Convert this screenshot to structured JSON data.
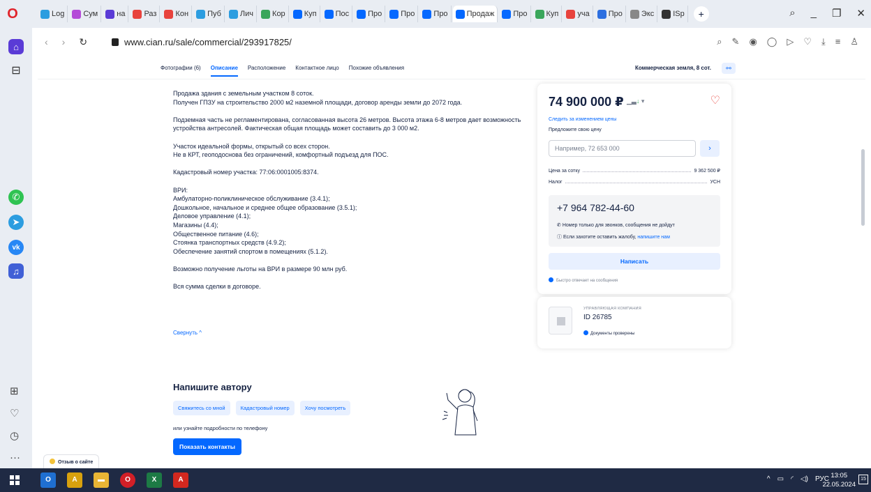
{
  "browser": {
    "tabs": [
      {
        "label": "Log",
        "color": "#2c9de0"
      },
      {
        "label": "Сум",
        "color": "#b44bd8"
      },
      {
        "label": "на",
        "color": "#5a3bd6"
      },
      {
        "label": "Раз",
        "color": "#e8433d"
      },
      {
        "label": "Кон",
        "color": "#e8433d"
      },
      {
        "label": "Пуб",
        "color": "#2c9de0"
      },
      {
        "label": "Лич",
        "color": "#2c9de0"
      },
      {
        "label": "Кор",
        "color": "#3aa65b"
      },
      {
        "label": "Куп",
        "color": "#0468ff"
      },
      {
        "label": "Пос",
        "color": "#0468ff"
      },
      {
        "label": "Про",
        "color": "#0468ff"
      },
      {
        "label": "Про",
        "color": "#0468ff"
      },
      {
        "label": "Про",
        "color": "#0468ff"
      },
      {
        "label": "Продаж",
        "color": "#0468ff",
        "active": true
      },
      {
        "label": "Про",
        "color": "#0468ff"
      },
      {
        "label": "Куп",
        "color": "#3aa65b"
      },
      {
        "label": "уча",
        "color": "#e8433d"
      },
      {
        "label": "Про",
        "color": "#2c6fe0"
      },
      {
        "label": "Экс",
        "color": "#888888"
      },
      {
        "label": "ISp",
        "color": "#333333"
      }
    ],
    "url": "www.cian.ru/sale/commercial/293917825/"
  },
  "subnav": {
    "tabs": [
      "Фотографии (6)",
      "Описание",
      "Расположение",
      "Контактное лицо",
      "Похожие объявления"
    ],
    "right_label": "Коммерческая земля, 8 сот."
  },
  "description": {
    "paragraphs": [
      "Продажа здания с земельным участком 8 соток.\nПолучен ГПЗУ на строительство 2000 м2 наземной площади, договор аренды земли до 2072 года.",
      "Подземная часть не регламентирована, согласованная высота 26 метров. Высота этажа 6-8 метров дает возможность устройства антресолей. Фактическая общая площадь может составить до 3 000 м2.",
      "Участок идеальной формы, открытый со всех сторон.\nНе в КРТ, геоподоснова без ограничений, комфортный подъезд для ПОС.",
      "Кадастровый номер участка: 77:06:0001005:8374.",
      "ВРИ:\nАмбулаторно-поликлиническое обслуживание (3.4.1);\nДошкольное, начальное и среднее общее образование (3.5.1);\nДеловое управление (4.1);\nМагазины (4.4);\nОбщественное питание (4.6);\nСтоянка транспортных средств (4.9.2);\nОбеспечение занятий спортом в помещениях (5.1.2).",
      "Возможно получение льготы на ВРИ в размере 90 млн руб.",
      "Вся сумма сделки в договоре."
    ],
    "collapse_label": "Свернуть ^"
  },
  "contact_author": {
    "title": "Напишите автору",
    "chips": [
      "Свяжитесь со мной",
      "Кадастровый номер",
      "Хочу посмотреть"
    ],
    "phone_hint": "или узнайте подробности по телефону",
    "button": "Показать контакты"
  },
  "price_card": {
    "price": "74 900 000 ₽",
    "track_link": "Следить за изменением цены",
    "offer_label": "Предложите свою цену",
    "offer_placeholder": "Например, 72 653 000",
    "price_per_sotka_label": "Цена за сотку",
    "price_per_sotka_value": "9 362 500 ₽",
    "tax_label": "Налог",
    "tax_value": "УСН",
    "phone": "+7 964 782-44-60",
    "note_calls": "Номер только для звонков, сообщения не дойдут",
    "note_complaint": "Если захотите оставить жалобу,",
    "note_complaint_link": "напишите нам",
    "write_button": "Написать",
    "fast_reply": "Быстро отвечает на сообщения"
  },
  "agency": {
    "kind": "УПРАВЛЯЮЩАЯ КОМПАНИЯ",
    "id": "ID 26785",
    "verified": "Документы проверены"
  },
  "feedback_tab": "Отзыв о сайте",
  "taskbar": {
    "lang": "РУС",
    "time": "13:05",
    "date": "22.05.2024",
    "notifications": "15"
  },
  "colors": {
    "accent": "#0468ff",
    "accent_light": "#e8f0ff",
    "text": "#152242",
    "favorite": "#e8433d"
  }
}
